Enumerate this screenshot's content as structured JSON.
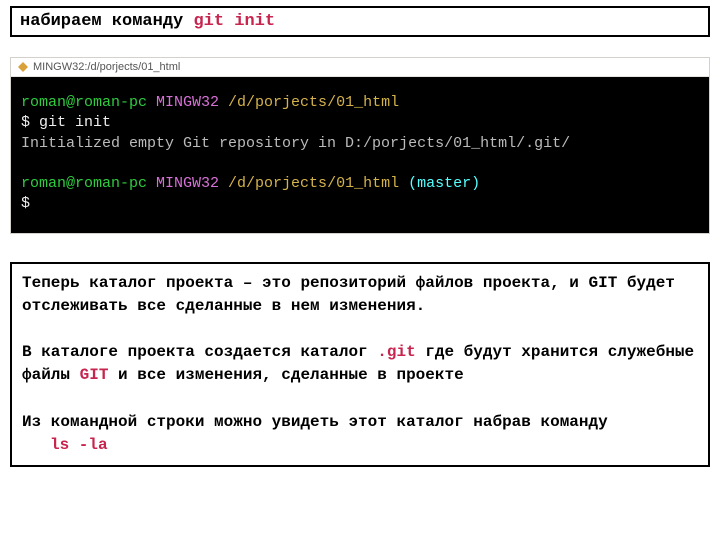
{
  "header": {
    "text_prefix": "набираем команду ",
    "command": "git init"
  },
  "titlebar": {
    "label": "MINGW32:/d/porjects/01_html"
  },
  "terminal": {
    "line1_user": "roman@roman-pc",
    "line1_sys": " MINGW32 ",
    "line1_path": "/d/porjects/01_html",
    "line2": "$ git init",
    "line3": "Initialized empty Git repository in D:/porjects/01_html/.git/",
    "line4_user": "roman@roman-pc",
    "line4_sys": " MINGW32 ",
    "line4_path": "/d/porjects/01_html ",
    "line4_branch": "(master)",
    "line5": "$"
  },
  "explain": {
    "p1": "Теперь каталог проекта – это репозиторий файлов проекта, и GIT будет отслеживать все сделанные в нем изменения.",
    "p2a": "В каталоге проекта создается каталог ",
    "p2_git": ".git",
    "p2b": " где будут хранится служебные файлы ",
    "p2_gitword": "GIT",
    "p2c": " и все изменения, сделанные в проекте",
    "p3": "Из командной строки можно увидеть этот каталог набрав команду",
    "p3_cmd": "ls -la"
  }
}
